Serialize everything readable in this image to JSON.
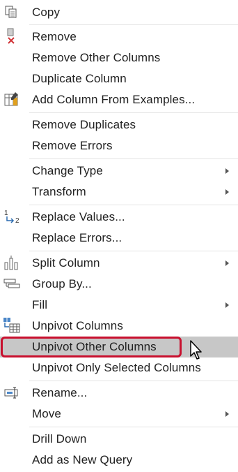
{
  "menu": {
    "items": [
      {
        "label": "Copy",
        "icon": "copy-icon"
      },
      {
        "label": "Remove",
        "icon": "remove-icon"
      },
      {
        "label": "Remove Other Columns"
      },
      {
        "label": "Duplicate Column"
      },
      {
        "label": "Add Column From Examples...",
        "icon": "column-examples-icon"
      },
      {
        "label": "Remove Duplicates"
      },
      {
        "label": "Remove Errors"
      },
      {
        "label": "Change Type",
        "submenu": true
      },
      {
        "label": "Transform",
        "submenu": true
      },
      {
        "label": "Replace Values...",
        "icon": "replace-values-icon"
      },
      {
        "label": "Replace Errors..."
      },
      {
        "label": "Split Column",
        "icon": "split-column-icon",
        "submenu": true
      },
      {
        "label": "Group By...",
        "icon": "group-by-icon"
      },
      {
        "label": "Fill",
        "submenu": true
      },
      {
        "label": "Unpivot Columns",
        "icon": "unpivot-icon"
      },
      {
        "label": "Unpivot Other Columns",
        "highlighted": true
      },
      {
        "label": "Unpivot Only Selected Columns"
      },
      {
        "label": "Rename...",
        "icon": "rename-icon"
      },
      {
        "label": "Move",
        "submenu": true
      },
      {
        "label": "Drill Down"
      },
      {
        "label": "Add as New Query"
      }
    ],
    "icon_glyphs": {
      "replace_values_1": "1",
      "replace_values_2": "2"
    },
    "colors": {
      "highlight": "#c7c7c7",
      "red_frame": "#c8102e",
      "text": "#222222"
    }
  }
}
